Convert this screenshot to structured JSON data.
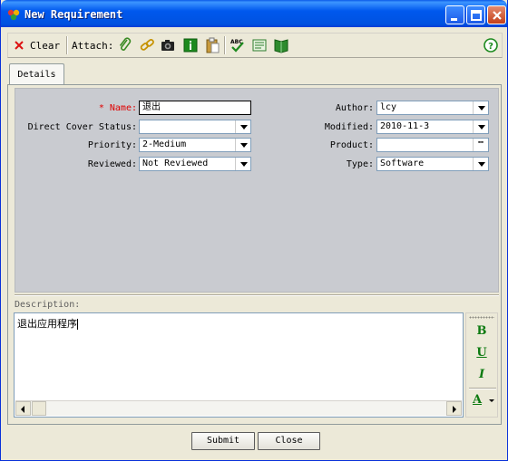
{
  "window": {
    "title": "New Requirement"
  },
  "toolbar": {
    "clear_label": "Clear",
    "attach_label": "Attach:",
    "icons": [
      "paperclip-icon",
      "link-icon",
      "camera-icon",
      "info-icon",
      "clipboard-icon",
      "spellcheck-icon",
      "form-icon",
      "book-icon",
      "help-icon"
    ]
  },
  "tabs": [
    {
      "label": "Details"
    }
  ],
  "form": {
    "name": {
      "label": "* Name:",
      "value": "退出"
    },
    "direct_cover_status": {
      "label": "Direct Cover Status:",
      "value": ""
    },
    "priority": {
      "label": "Priority:",
      "value": "2-Medium"
    },
    "reviewed": {
      "label": "Reviewed:",
      "value": "Not Reviewed"
    },
    "author": {
      "label": "Author:",
      "value": "lcy"
    },
    "modified": {
      "label": "Modified:",
      "value": "2010-11-3"
    },
    "product": {
      "label": "Product:",
      "value": ""
    },
    "type": {
      "label": "Type:",
      "value": "Software"
    }
  },
  "description": {
    "label": "Description:",
    "text": "退出应用程序"
  },
  "formatting": {
    "bold": "B",
    "underline": "U",
    "italic": "I",
    "color": "A"
  },
  "buttons": {
    "submit": "Submit",
    "close": "Close"
  },
  "colors": {
    "title_bar": "#0058ee",
    "required_label": "#e00000",
    "details_bg": "#c9cbd0",
    "format_icons": "#0c7a10"
  }
}
